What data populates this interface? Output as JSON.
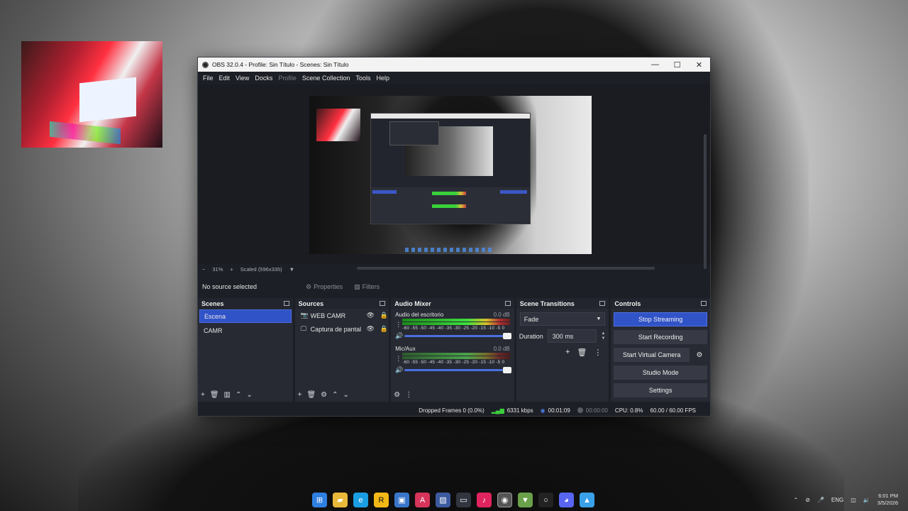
{
  "window": {
    "title": "OBS 32.0.4 - Profile: Sin Título - Scenes: Sin Título",
    "controls": {
      "minimize": "—",
      "maximize": "☐",
      "close": "✕"
    }
  },
  "menu": [
    "File",
    "Edit",
    "View",
    "Docks",
    "Profile",
    "Scene Collection",
    "Tools",
    "Help"
  ],
  "preview": {
    "zoom_minus": "−",
    "zoom": "31%",
    "zoom_plus": "+",
    "scale_label": "Scaled (596x335)",
    "scale_caret": "▼"
  },
  "source_toolbar": {
    "no_source": "No source selected",
    "properties": "Properties",
    "filters": "Filters"
  },
  "scenes": {
    "title": "Scenes",
    "items": [
      "Escena",
      "CAMR"
    ],
    "selected": "Escena"
  },
  "sources": {
    "title": "Sources",
    "items": [
      {
        "label": "WEB CAMR",
        "icon": "camera-icon"
      },
      {
        "label": "Captura de pantal",
        "icon": "monitor-icon"
      }
    ]
  },
  "mixer": {
    "title": "Audio Mixer",
    "channels": [
      {
        "name": "Audio del escritorio",
        "db": "0.0 dB",
        "ticks": "-60 -55 -50 -45 -40 -35 -30 -25 -20 -15 -10 -5 0"
      },
      {
        "name": "Mic/Aux",
        "db": "0.0 dB",
        "ticks": "-60 -55 -50 -45 -40 -35 -30 -25 -20 -15 -10 -5 0"
      }
    ]
  },
  "transitions": {
    "title": "Scene Transitions",
    "selected": "Fade",
    "duration_label": "Duration",
    "duration_value": "300 ms"
  },
  "controls": {
    "title": "Controls",
    "stop_streaming": "Stop Streaming",
    "start_recording": "Start Recording",
    "start_virtual_camera": "Start Virtual Camera",
    "studio_mode": "Studio Mode",
    "settings": "Settings"
  },
  "status": {
    "dropped_frames": "Dropped Frames 0 (0.0%)",
    "bitrate": "6331 kbps",
    "stream_time": "00:01:09",
    "record_time": "00:00:00",
    "cpu": "CPU: 0.8%",
    "fps": "60.00 / 60.00 FPS"
  },
  "tray": {
    "language": "ENG",
    "time": "6:01 PM",
    "date": "3/5/2026"
  },
  "colors": {
    "accent": "#3153c8",
    "panel": "#272a33",
    "window_bg": "#1d1f26"
  }
}
